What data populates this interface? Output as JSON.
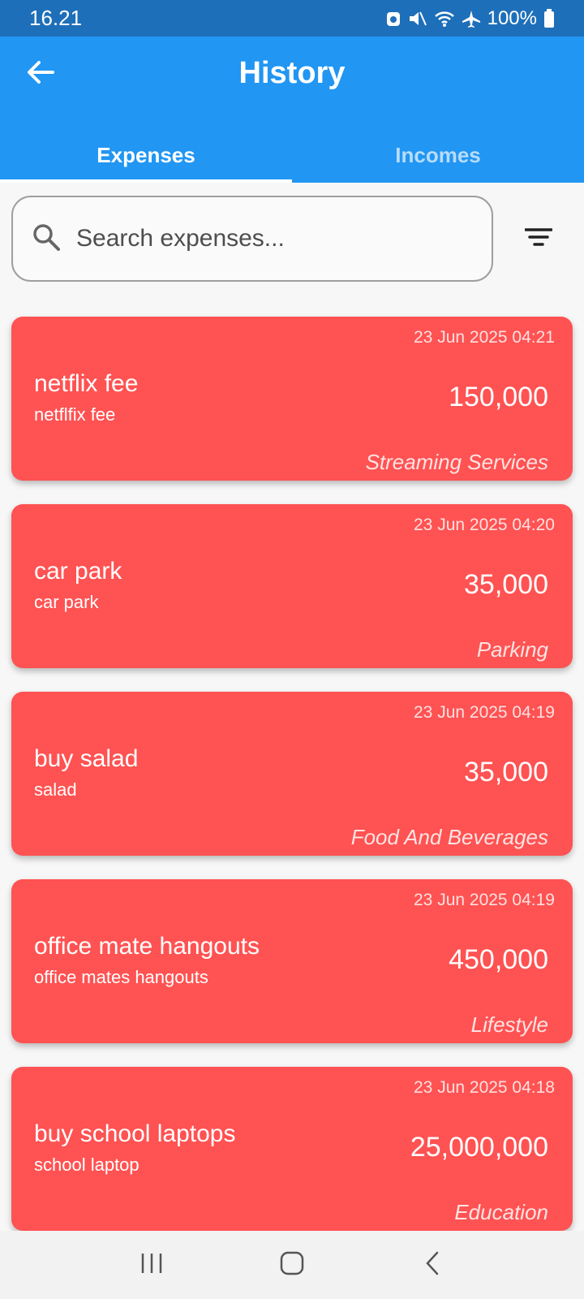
{
  "status_bar": {
    "time": "16.21",
    "battery": "100%"
  },
  "app_bar": {
    "title": "History"
  },
  "tabs": [
    {
      "label": "Expenses",
      "active": true
    },
    {
      "label": "Incomes",
      "active": false
    }
  ],
  "search": {
    "placeholder": "Search expenses...",
    "value": ""
  },
  "expenses": [
    {
      "date": "23 Jun 2025 04:21",
      "title": "netflix fee",
      "description": "netflfix fee",
      "amount": "150,000",
      "category": "Streaming Services"
    },
    {
      "date": "23 Jun 2025 04:20",
      "title": "car park",
      "description": "car park",
      "amount": "35,000",
      "category": "Parking"
    },
    {
      "date": "23 Jun 2025 04:19",
      "title": "buy salad",
      "description": "salad",
      "amount": "35,000",
      "category": "Food And Beverages"
    },
    {
      "date": "23 Jun 2025 04:19",
      "title": "office mate hangouts",
      "description": "office mates hangouts",
      "amount": "450,000",
      "category": "Lifestyle"
    },
    {
      "date": "23 Jun 2025 04:18",
      "title": "buy school laptops",
      "description": "school laptop",
      "amount": "25,000,000",
      "category": "Education"
    }
  ],
  "colors": {
    "app_bar": "#2196f3",
    "status_bar": "#1e6fb9",
    "expense_card": "#ff5252"
  },
  "icons": {
    "back": "arrow-left-icon",
    "search": "search-icon",
    "filter": "sort-icon",
    "nav_recents": "recents-icon",
    "nav_home": "home-icon",
    "nav_back": "back-icon"
  }
}
